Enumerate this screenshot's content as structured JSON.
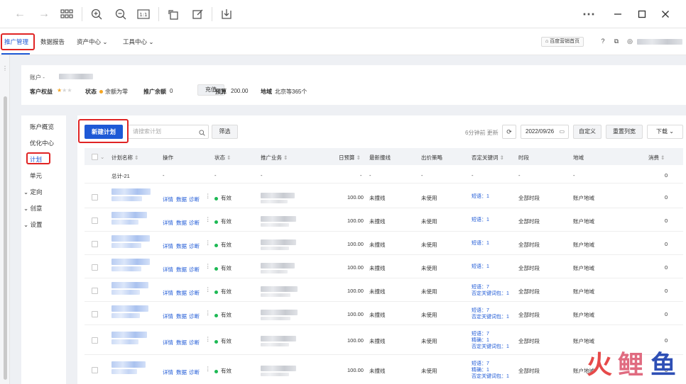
{
  "toolbar": {
    "icons": [
      "back-icon",
      "forward-icon",
      "grid-icon",
      "zoom-in-icon",
      "zoom-out-icon",
      "fit-width-icon",
      "rotate-icon",
      "edit-icon",
      "download-icon",
      "more-icon",
      "minimize-icon",
      "maximize-icon",
      "close-icon"
    ]
  },
  "nav": {
    "items": [
      "推广管理",
      "数据报告",
      "资产中心",
      "工具中心"
    ],
    "home_label": "百度营销首页"
  },
  "account": {
    "label": "账户 -",
    "rights_label": "客户权益",
    "status_label": "状态",
    "status_value": "余额为零",
    "balance_label": "推广余额",
    "balance_value": "0",
    "charge_label": "充值",
    "budget_label": "预算",
    "budget_value": "200.00",
    "region_label": "地域",
    "region_value": "北京等365个"
  },
  "side_menu": [
    "账户概览",
    "优化中心",
    "计划",
    "单元",
    "定向",
    "创意",
    "设置"
  ],
  "toolbar2": {
    "new_plan": "新建计划",
    "search_placeholder": "请搜索计划",
    "filter": "筛选",
    "updated": "6分钟前 更新",
    "date": "2022/09/26",
    "customize": "自定义",
    "reset_columns": "重置列宽",
    "download": "下载"
  },
  "table": {
    "headers": [
      "计划名称",
      "操作",
      "状态",
      "推广业务",
      "日预算",
      "最新撞线",
      "出价策略",
      "否定关键词",
      "时段",
      "地域",
      "消费"
    ],
    "total_row": {
      "name": "总计-21",
      "op": "-",
      "status": "-",
      "biz": "-",
      "budget": "-",
      "latest": "-",
      "bid": "-",
      "neg": "-",
      "time": "-",
      "region": "-",
      "cost": "0"
    },
    "actions": [
      "详情",
      "数据",
      "诊断"
    ],
    "rows": [
      {
        "status": "有效",
        "budget": "100.00",
        "latest": "未撞线",
        "bid": "未使用",
        "neg": [
          "短语：1"
        ],
        "time": "全部时段",
        "region": "账户地域",
        "cost": "0"
      },
      {
        "status": "有效",
        "budget": "100.00",
        "latest": "未撞线",
        "bid": "未使用",
        "neg": [
          "短语：1"
        ],
        "time": "全部时段",
        "region": "账户地域",
        "cost": "0"
      },
      {
        "status": "有效",
        "budget": "100.00",
        "latest": "未撞线",
        "bid": "未使用",
        "neg": [
          "短语：1"
        ],
        "time": "全部时段",
        "region": "账户地域",
        "cost": "0"
      },
      {
        "status": "有效",
        "budget": "100.00",
        "latest": "未撞线",
        "bid": "未使用",
        "neg": [
          "短语：1"
        ],
        "time": "全部时段",
        "region": "账户地域",
        "cost": "0"
      },
      {
        "status": "有效",
        "budget": "100.00",
        "latest": "未撞线",
        "bid": "未使用",
        "neg": [
          "短语：7",
          "否定关键词包：1"
        ],
        "time": "全部时段",
        "region": "账户地域",
        "cost": "0"
      },
      {
        "status": "有效",
        "budget": "100.00",
        "latest": "未撞线",
        "bid": "未使用",
        "neg": [
          "短语：7",
          "否定关键词包：1"
        ],
        "time": "全部时段",
        "region": "账户地域",
        "cost": "0"
      },
      {
        "status": "有效",
        "budget": "100.00",
        "latest": "未撞线",
        "bid": "未使用",
        "neg": [
          "短语：7",
          "精确：1",
          "否定关键词包：1"
        ],
        "time": "全部时段",
        "region": "账户地域",
        "cost": "0"
      },
      {
        "status": "有效",
        "budget": "100.00",
        "latest": "未撞线",
        "bid": "未使用",
        "neg": [
          "短语：7",
          "精确：1",
          "否定关键词包：1"
        ],
        "time": "全部时段",
        "region": "账户地域",
        "cost": "0"
      }
    ]
  },
  "colors": {
    "accent": "#1e59d6",
    "highlight": "#e02424",
    "status_ok": "#1db954"
  },
  "watermark": [
    "火",
    "鲤",
    "鱼"
  ]
}
